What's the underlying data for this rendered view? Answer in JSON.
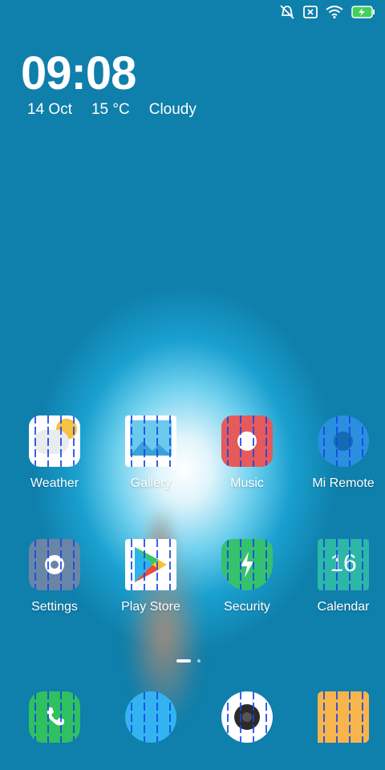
{
  "status": {
    "icons": [
      "bell-off-icon",
      "sim-x-icon",
      "wifi-icon",
      "battery-charging-icon"
    ]
  },
  "clock": {
    "time": "09:08"
  },
  "weather": {
    "date": "14 Oct",
    "temp": "15 °C",
    "condition": "Cloudy"
  },
  "apps_row1": [
    {
      "label": "Weather"
    },
    {
      "label": "Gallery"
    },
    {
      "label": "Music"
    },
    {
      "label": "Mi Remote"
    }
  ],
  "apps_row2": [
    {
      "label": "Settings"
    },
    {
      "label": "Play Store"
    },
    {
      "label": "Security"
    },
    {
      "label": "Calendar",
      "day": "16"
    }
  ],
  "dock": [
    {
      "icon": "phone-icon"
    },
    {
      "icon": "messages-icon"
    },
    {
      "icon": "camera-icon"
    },
    {
      "icon": "browser-icon"
    }
  ],
  "colors": {
    "weather": "#ffffff",
    "gallery": "#ffffff",
    "music": "#e55a5a",
    "remote": "#2b8fe0",
    "settings": "#6a86a6",
    "play": "#ffffff",
    "security": "#35c26e",
    "calendar": "#2cb7a6",
    "phone": "#2fc060",
    "messages": "#33b4f0",
    "camera": "#ffffff",
    "browser": "#f7b54b"
  }
}
